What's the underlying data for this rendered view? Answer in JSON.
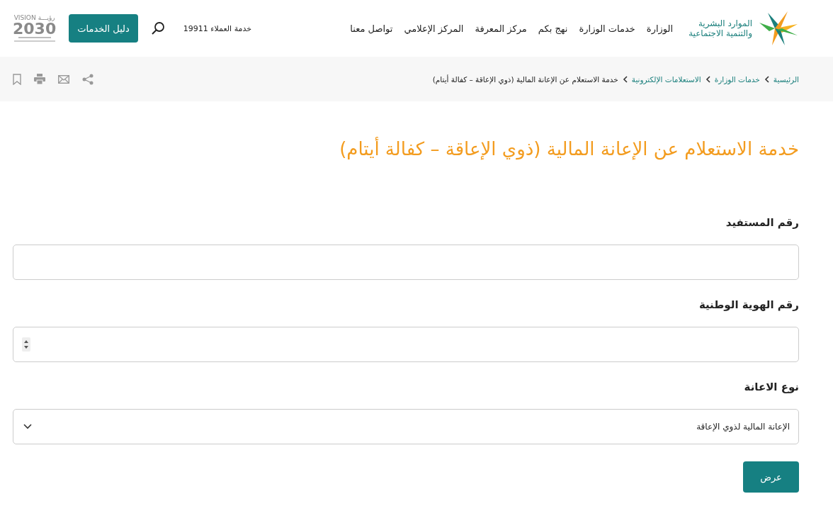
{
  "header": {
    "ministry_logo": [
      "الموارد البشرية",
      "والتنمية الاجتماعية"
    ],
    "nav": [
      "الوزارة",
      "خدمات الوزارة",
      "نهج بكم",
      "مركز المعرفة",
      "المركز الإعلامي",
      "تواصل معنا"
    ],
    "customer_service": "خدمة العملاء 19911",
    "services_button": "دليل الخدمات",
    "vision_logo": {
      "arabic": "رؤيـــة",
      "latin": "VISION",
      "year": "2030"
    }
  },
  "breadcrumb": [
    {
      "label": "الرئيسية",
      "link": true
    },
    {
      "label": "خدمات الوزارة",
      "link": true
    },
    {
      "label": "الاستعلامات الإلكترونية",
      "link": true
    },
    {
      "label": "خدمة الاستعلام عن الإعانة المالية (ذوي الإعاقة – كفالة أيتام)",
      "link": false
    }
  ],
  "title": "خدمة الاستعلام عن الإعانة المالية (ذوي الإعاقة – كفالة أيتام)",
  "form": {
    "fields": [
      {
        "kind": "text",
        "label": "رقم المستفيد"
      },
      {
        "kind": "number",
        "label": "رقم الهوية الوطنية"
      },
      {
        "kind": "select",
        "label": "نوع الاعانة",
        "value": "الإعانة المالية لذوي الإعاقة"
      }
    ],
    "submit": "عرض"
  }
}
